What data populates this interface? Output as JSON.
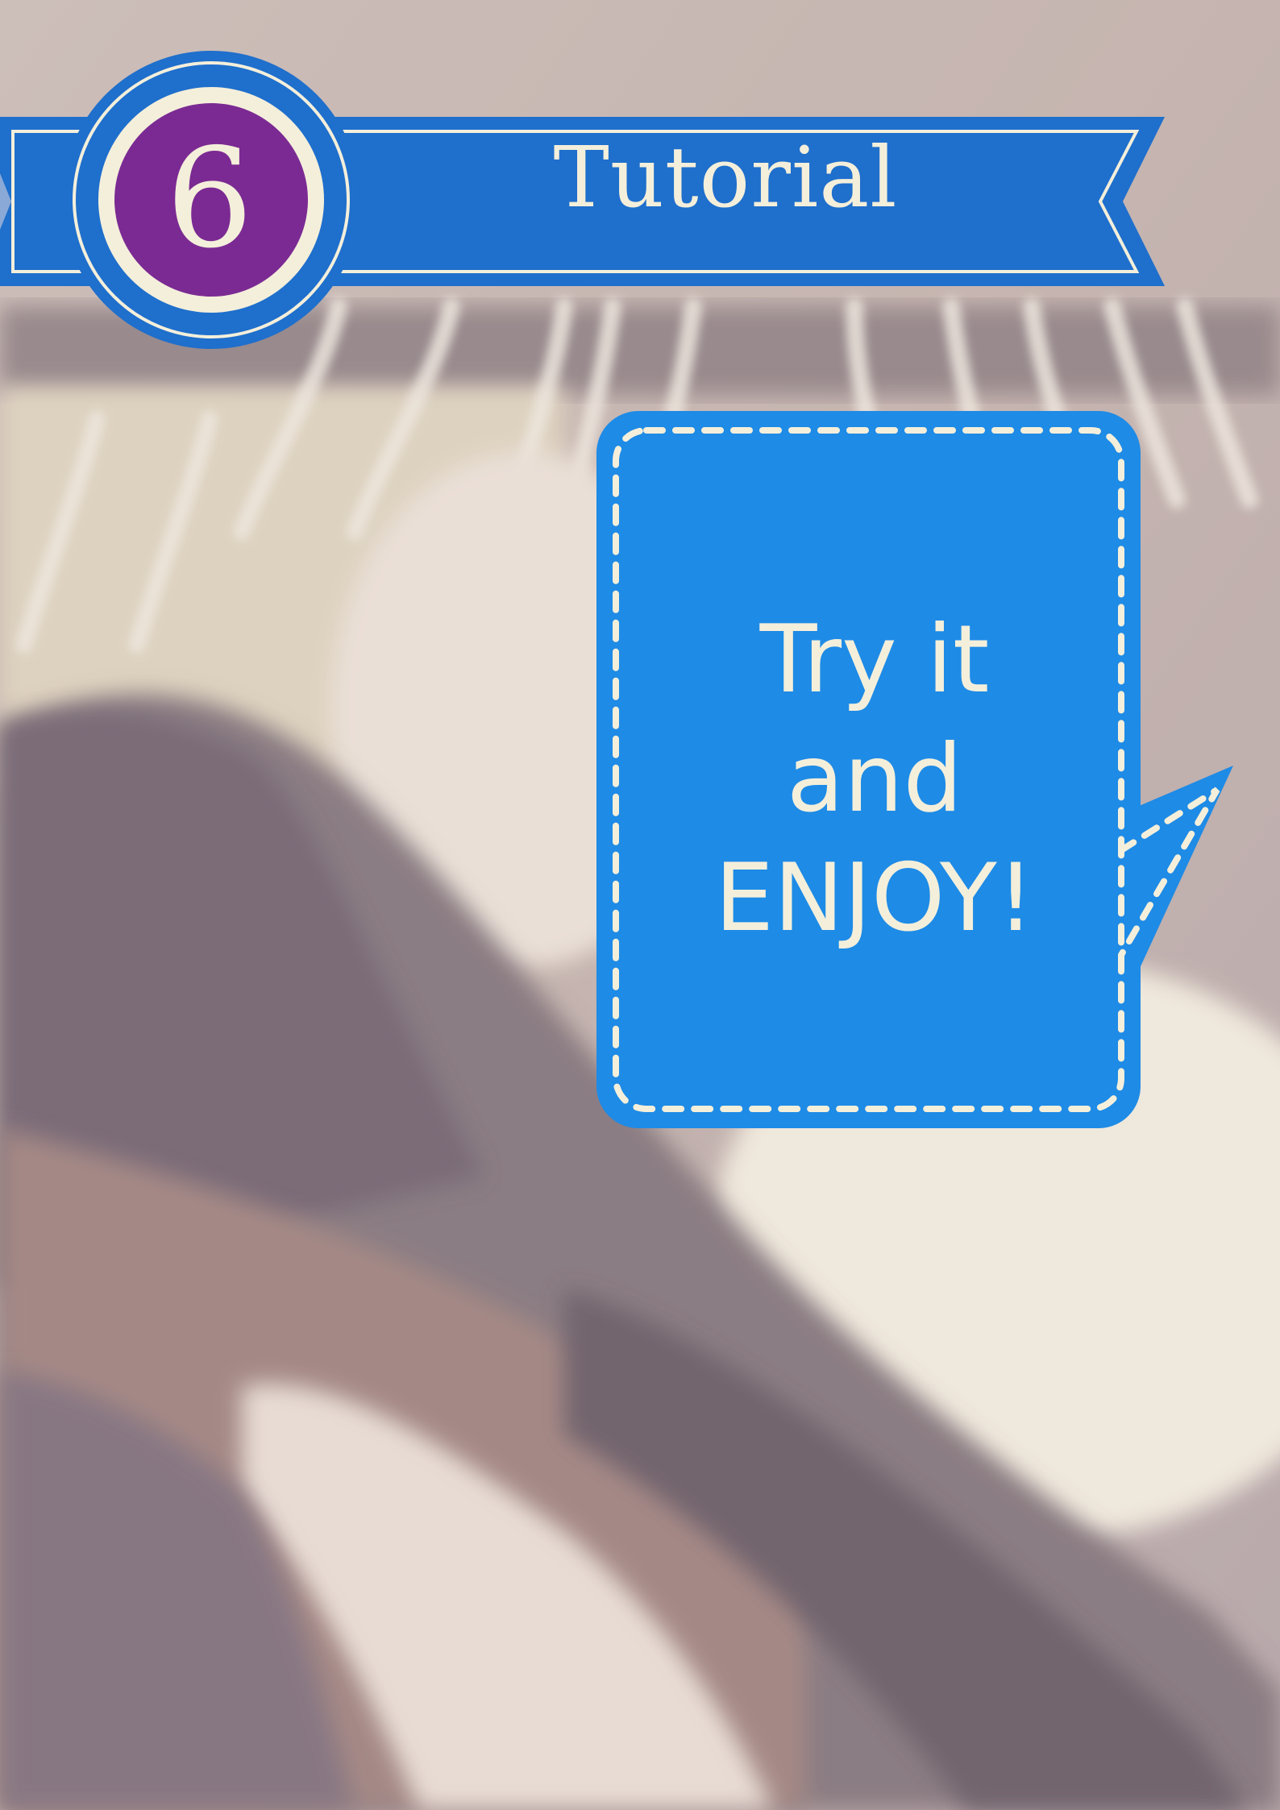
{
  "banner": {
    "step_number": "6",
    "title": "Tutorial"
  },
  "speech_bubble": {
    "lines": [
      "Try it",
      "and",
      "ENJOY!"
    ]
  },
  "colors": {
    "ribbon_blue": "#1f6fcc",
    "bubble_blue": "#1e8be6",
    "badge_purple": "#7b2a93",
    "cream": "#f4efdb"
  },
  "background": {
    "description_icon": "clothes-on-hangers-photo"
  }
}
